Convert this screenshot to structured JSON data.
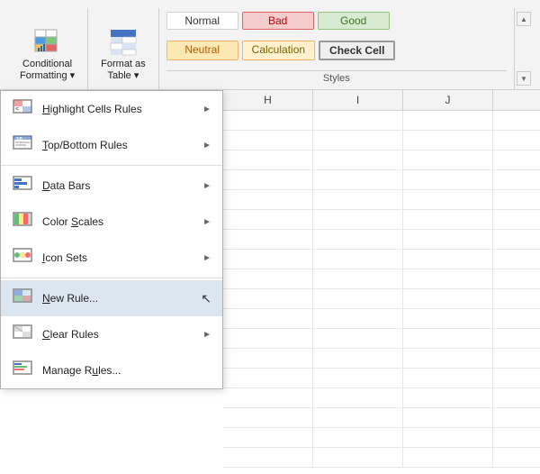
{
  "ribbon": {
    "conditional_formatting_label": "Conditional\nFormatting *",
    "format_as_table_label": "Format as\nTable *",
    "styles_title": "Styles",
    "cells": {
      "normal": "Normal",
      "bad": "Bad",
      "good": "Good",
      "neutral": "Neutral",
      "calculation": "Calculation",
      "check_cell": "Check Cell"
    }
  },
  "menu": {
    "items": [
      {
        "id": "highlight-cells-rules",
        "label": "Highlight Cells Rules",
        "acc_index": 1,
        "has_arrow": true
      },
      {
        "id": "top-bottom-rules",
        "label": "Top/Bottom Rules",
        "acc_index": 0,
        "has_arrow": true
      },
      {
        "id": "data-bars",
        "label": "Data Bars",
        "acc_index": 0,
        "has_arrow": true
      },
      {
        "id": "color-scales",
        "label": "Color Scales",
        "acc_index": 6,
        "has_arrow": true
      },
      {
        "id": "icon-sets",
        "label": "Icon Sets",
        "acc_index": 0,
        "has_arrow": true
      },
      {
        "id": "new-rule",
        "label": "New Rule...",
        "acc_index": 0,
        "has_arrow": false,
        "active": true
      },
      {
        "id": "clear-rules",
        "label": "Clear Rules",
        "acc_index": 0,
        "has_arrow": true
      },
      {
        "id": "manage-rules",
        "label": "Manage Rules...",
        "acc_index": 7,
        "has_arrow": false
      }
    ]
  },
  "grid": {
    "columns": [
      "H",
      "I",
      "J"
    ],
    "rows": 18
  }
}
